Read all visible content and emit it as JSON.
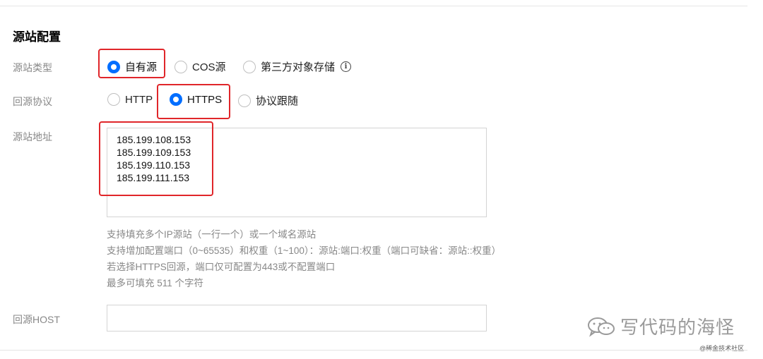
{
  "section": {
    "title": "源站配置"
  },
  "origin_type": {
    "label": "源站类型",
    "options": [
      "自有源",
      "COS源",
      "第三方对象存储"
    ],
    "selected": "自有源",
    "info_icon": "ⓘ"
  },
  "origin_protocol": {
    "label": "回源协议",
    "options": [
      "HTTP",
      "HTTPS",
      "协议跟随"
    ],
    "selected": "HTTPS"
  },
  "origin_address": {
    "label": "源站地址",
    "ips": [
      "185.199.108.153",
      "185.199.109.153",
      "185.199.110.153",
      "185.199.111.153"
    ],
    "hints": [
      "支持填充多个IP源站（一行一个）或一个域名源站",
      "支持增加配置端口（0~65535）和权重（1~100）：源站:端口:权重（端口可缺省：源站::权重）",
      "若选择HTTPS回源，端口仅可配置为443或不配置端口",
      "最多可填充 511 个字符"
    ]
  },
  "origin_host": {
    "label": "回源HOST",
    "value": ""
  },
  "watermark": {
    "text": "写代码的海怪",
    "sub": "@稀金技术社区"
  },
  "colors": {
    "accent": "#006eff",
    "highlight": "#e0262a"
  }
}
